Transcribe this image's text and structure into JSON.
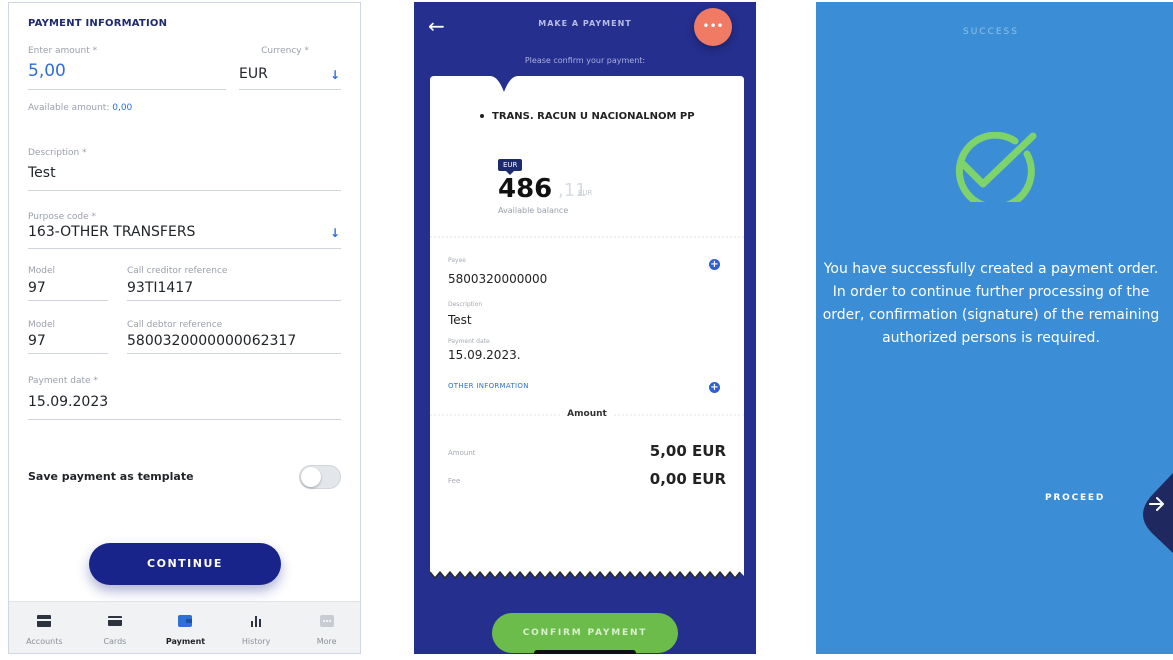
{
  "form": {
    "title": "PAYMENT INFORMATION",
    "amount_label": "Enter amount *",
    "amount_value": "5,00",
    "currency_label": "Currency *",
    "currency_value": "EUR",
    "available_prefix": "Available amount:",
    "available_value": "0,00",
    "description_label": "Description *",
    "description_value": "Test",
    "purpose_label": "Purpose code *",
    "purpose_value": "163-OTHER TRANSFERS",
    "model1_label": "Model",
    "model1_value": "97",
    "creditor_ref_label": "Call creditor reference",
    "creditor_ref_value": "93TI1417",
    "model2_label": "Model",
    "model2_value": "97",
    "debtor_ref_label": "Call debtor reference",
    "debtor_ref_value": "5800320000000062317",
    "date_label": "Payment date *",
    "date_value": "15.09.2023",
    "template_label": "Save payment as template",
    "template_on": false,
    "continue_label": "CONTINUE"
  },
  "tabs": [
    {
      "label": "Accounts",
      "icon": "wallet-icon",
      "active": false
    },
    {
      "label": "Cards",
      "icon": "card-icon",
      "active": false
    },
    {
      "label": "Payment",
      "icon": "folder-icon",
      "active": true
    },
    {
      "label": "History",
      "icon": "bar-chart-icon",
      "active": false
    },
    {
      "label": "More",
      "icon": "more-icon",
      "active": false
    }
  ],
  "confirm": {
    "title": "MAKE A PAYMENT",
    "more_label": "•••",
    "subtitle": "Please confirm your payment:",
    "account_name": "TRANS. RACUN U NACIONALNOM PP",
    "currency_badge": "EUR",
    "balance_int": "486",
    "balance_dec": ",11",
    "balance_currency": "EUR",
    "balance_label": "Available balance",
    "payee_label": "Payee",
    "payee_value": "5800320000000",
    "desc_label": "Description",
    "desc_value": "Test",
    "date_label": "Payment date",
    "date_value": "15.09.2023.",
    "other_info": "OTHER INFORMATION",
    "amount_header": "Amount",
    "amount_label": "Amount",
    "amount_value": "5,00 EUR",
    "fee_label": "Fee",
    "fee_value": "0,00 EUR",
    "confirm_button": "CONFIRM PAYMENT"
  },
  "success": {
    "title": "SUCCESS",
    "message": "You have successfully created a payment order. In order to continue further processing of the order, confirmation (signature) of the remaining authorized persons is required.",
    "proceed_label": "PROCEED",
    "proceed_icon": "arrow-right-icon"
  },
  "colors": {
    "brand_navy": "#19248a",
    "confirm_bg": "#242f8e",
    "success_bg": "#3b8ed6",
    "check_green": "#7ed46b",
    "confirm_green": "#6cbc4b",
    "more_coral": "#f07a63"
  }
}
